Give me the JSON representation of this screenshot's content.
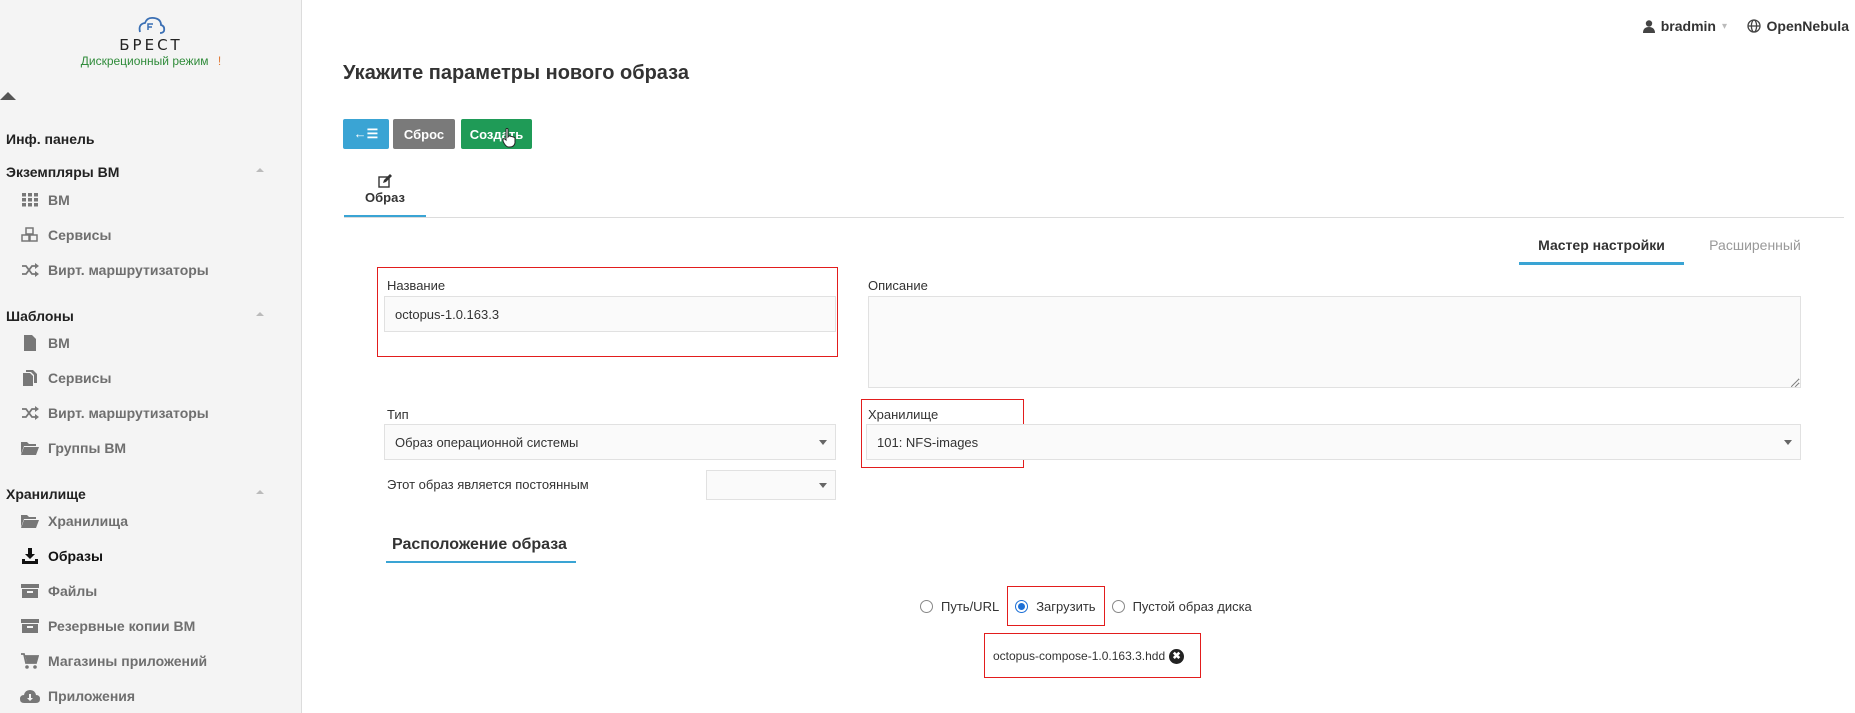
{
  "sidebar": {
    "logo_text": "БРЕСТ",
    "mode": "Дискреционный режим",
    "mode_mark": "!",
    "groups": {
      "dashboard": "Инф. панель",
      "vm_instances": "Экземпляры ВМ",
      "templates": "Шаблоны",
      "storage": "Хранилище"
    },
    "items": {
      "vm": "ВМ",
      "services": "Сервисы",
      "vrouters": "Вирт. маршрутизаторы",
      "tpl_vm": "ВМ",
      "tpl_services": "Сервисы",
      "tpl_vrouters": "Вирт. маршрутизаторы",
      "vm_groups": "Группы ВМ",
      "datastores": "Хранилища",
      "images": "Образы",
      "files": "Файлы",
      "backups": "Резервные копии ВМ",
      "marketplaces": "Магазины приложений",
      "apps": "Приложения"
    }
  },
  "topbar": {
    "user": "bradmin",
    "cloud": "OpenNebula"
  },
  "page": {
    "title": "Укажите параметры нового образа"
  },
  "toolbar": {
    "back_label": "←☰",
    "reset_label": "Сброс",
    "create_label": "Создать"
  },
  "tabs": {
    "image": "Образ"
  },
  "modes": {
    "wizard": "Мастер настройки",
    "advanced": "Расширенный"
  },
  "form": {
    "name_label": "Название",
    "name_value": "octopus-1.0.163.3",
    "description_label": "Описание",
    "type_label": "Тип",
    "type_value": "Образ операционной системы",
    "datastore_label": "Хранилище",
    "datastore_value": "101: NFS-images",
    "persistent_label": "Этот образ является постоянным",
    "persistent_value": ""
  },
  "location": {
    "title": "Расположение образа",
    "options": {
      "path": "Путь/URL",
      "upload": "Загрузить",
      "empty": "Пустой образ диска"
    },
    "selected": "upload",
    "file_name": "octopus-compose-1.0.163.3.hdd",
    "remove_glyph": "✖"
  },
  "colors": {
    "accent": "#3aa4d4",
    "create": "#1f9b57",
    "reset": "#7a7a7a",
    "highlight": "#e21d1d",
    "mode": "#2f8b3a"
  }
}
